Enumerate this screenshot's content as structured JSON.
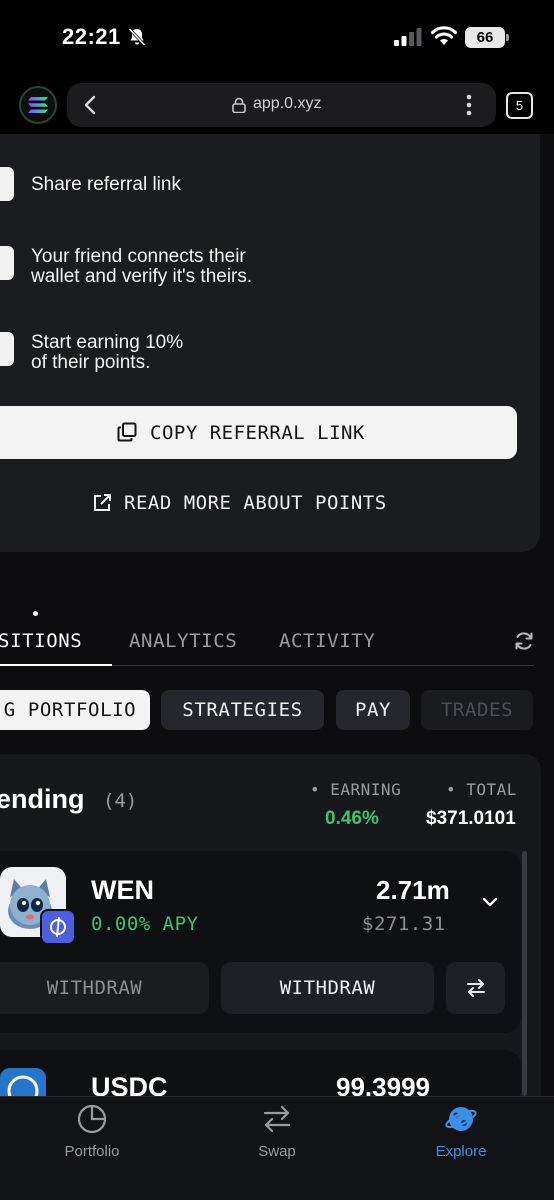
{
  "status_bar": {
    "time": "22:21",
    "battery": "66",
    "icons": [
      "bell-slash-icon",
      "signal-icon",
      "wifi-icon",
      "battery-icon"
    ]
  },
  "browser": {
    "url": "app.0.xyz",
    "tab_count": "5",
    "icons": [
      "back-icon",
      "lock-icon",
      "more-icon"
    ]
  },
  "referral": {
    "steps": [
      {
        "text": "Share referral link"
      },
      {
        "line1": "Your friend connects their",
        "line2": "wallet and verify it's theirs."
      },
      {
        "line1": "Start earning 10%",
        "line2": "of their points."
      }
    ],
    "copy_button": "COPY REFERRAL LINK",
    "read_more": "READ MORE ABOUT POINTS"
  },
  "tabs": [
    "OSITIONS",
    "ANALYTICS",
    "ACTIVITY"
  ],
  "pills": [
    "G PORTFOLIO",
    "STRATEGIES",
    "PAY",
    "TRADES"
  ],
  "lending": {
    "title": "ending",
    "count": "(4)",
    "earning_label": "EARNING",
    "earning_value": "0.46%",
    "total_label": "TOTAL",
    "total_value": "$371.0101",
    "assets": [
      {
        "symbol": "WEN",
        "apy": "0.00% APY",
        "amount": "2.71m",
        "usd": "$271.31",
        "withdraw_left": "WITHDRAW",
        "withdraw_right": "WITHDRAW"
      },
      {
        "symbol": "USDC",
        "amount": "99.3999"
      }
    ]
  },
  "nav": [
    {
      "label": "Portfolio"
    },
    {
      "label": "Swap"
    },
    {
      "label": "Explore"
    }
  ],
  "colors": {
    "accent_green": "#3ec275",
    "accent_blue": "#3d8fe6",
    "background": "#0d0d0f"
  }
}
